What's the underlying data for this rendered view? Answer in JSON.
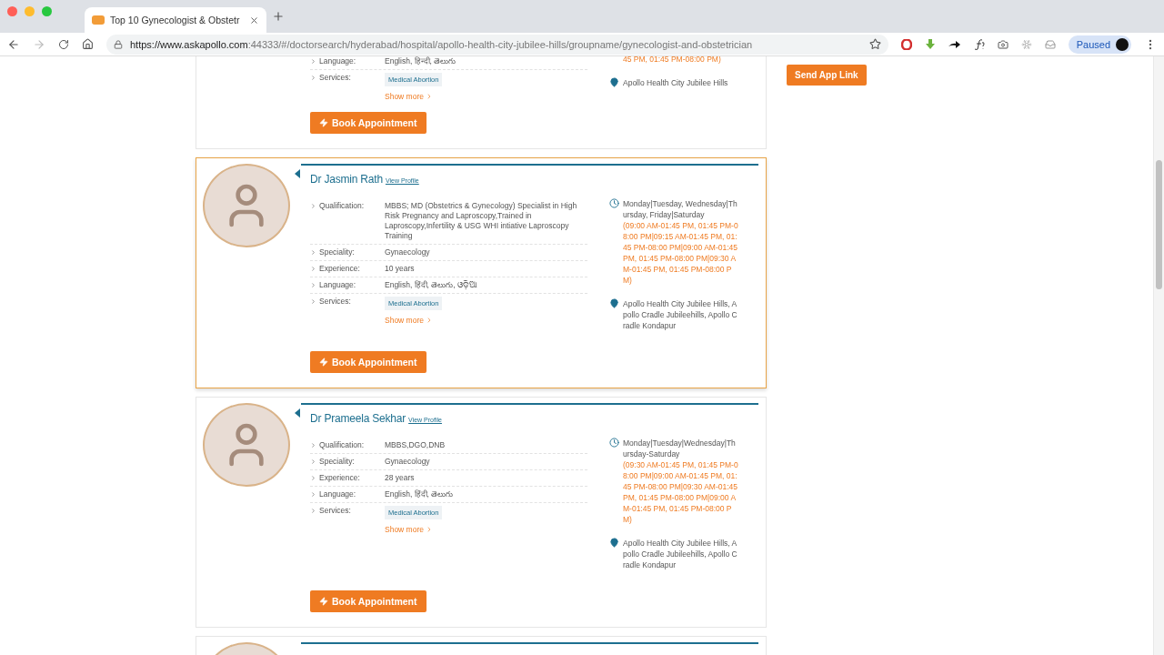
{
  "browser": {
    "tab": {
      "title": "Top 10 Gynecologist & Obstetr"
    },
    "url": {
      "host": "https://www.askapollo.com",
      "path": ":44333/#/doctorsearch/hyderabad/hospital/apollo-health-city-jubilee-hills/groupname/gynecologist-and-obstetrician"
    },
    "profile": {
      "label": "Paused"
    }
  },
  "doctors": [
    {
      "highlighted": false,
      "details": [
        {
          "label": "Language:",
          "value": "English, हिन्दी, తెలుగు",
          "kind": "text"
        },
        {
          "label": "Services:",
          "value": "Medical Abortion",
          "kind": "tag"
        }
      ],
      "show_more": "Show more",
      "hours": "45 PM, 01:45 PM-08:00 PM)",
      "address": "Apollo Health City Jubilee Hills",
      "book": "Book Appointment"
    },
    {
      "photo": true,
      "highlighted": true,
      "name": "Dr Jasmin Rath",
      "view_profile": "View Profile",
      "details": [
        {
          "label": "Qualification:",
          "value": "MBBS; MD (Obstetrics & Gynecology) Specialist in High Risk Pregnancy and Laproscopy,Trained in Laproscopy,Infertility & USG WHI intiative Laproscopy Training",
          "kind": "text"
        },
        {
          "label": "Speciality:",
          "value": "Gynaecology",
          "kind": "text"
        },
        {
          "label": "Experience:",
          "value": "10 years",
          "kind": "text"
        },
        {
          "label": "Language:",
          "value": "English, हिंदी, తెలుగు, ଓଡ଼ିଆ",
          "kind": "text"
        },
        {
          "label": "Services:",
          "value": "Medical Abortion",
          "kind": "tag"
        }
      ],
      "show_more": "Show more",
      "days": "Monday|Tuesday, Wednesday|Thursday, Friday|Saturday",
      "hours": "(09:00 AM-01:45 PM, 01:45 PM-08:00 PM|09:15 AM-01:45 PM, 01:45 PM-08:00 PM|09:00 AM-01:45 PM, 01:45 PM-08:00 PM|09:30 AM-01:45 PM, 01:45 PM-08:00 PM)",
      "address": "Apollo Health City Jubilee Hills, Apollo Cradle Jubileehills, Apollo Cradle Kondapur",
      "book": "Book Appointment"
    },
    {
      "photo": true,
      "highlighted": false,
      "name": "Dr Prameela Sekhar",
      "view_profile": "View Profile",
      "details": [
        {
          "label": "Qualification:",
          "value": "MBBS,DGO,DNB",
          "kind": "text"
        },
        {
          "label": "Speciality:",
          "value": "Gynaecology",
          "kind": "text"
        },
        {
          "label": "Experience:",
          "value": "28 years",
          "kind": "text"
        },
        {
          "label": "Language:",
          "value": "English, हिंदी, తెలుగు",
          "kind": "text"
        },
        {
          "label": "Services:",
          "value": "Medical Abortion",
          "kind": "tag"
        }
      ],
      "show_more": "Show more",
      "days": "Monday|Tuesday|Wednesday|Thursday-Saturday",
      "hours": "(09:30 AM-01:45 PM, 01:45 PM-08:00 PM|09:00 AM-01:45 PM, 01:45 PM-08:00 PM|09:30 AM-01:45 PM, 01:45 PM-08:00 PM|09:00 AM-01:45 PM, 01:45 PM-08:00 PM)",
      "address": "Apollo Health City Jubilee Hills, Apollo Cradle Jubileehills, Apollo Cradle Kondapur",
      "book": "Book Appointment"
    },
    {
      "photo": true,
      "highlighted": false
    }
  ],
  "sidebar": {
    "button": "Send App Link"
  }
}
